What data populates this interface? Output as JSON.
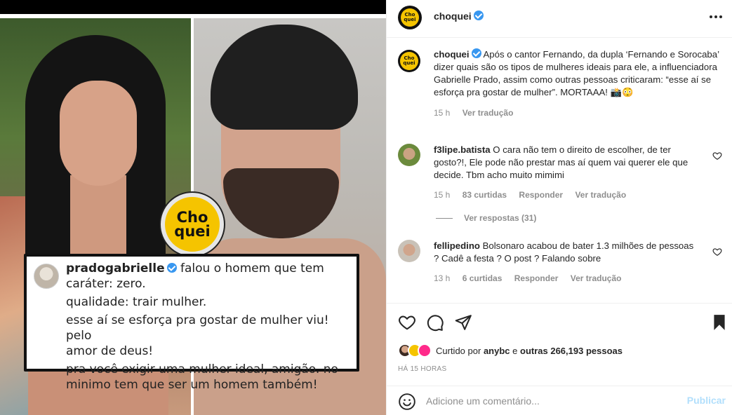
{
  "post_image": {
    "logo_text_top": "Cho",
    "logo_text_bottom": "quei",
    "comment_card": {
      "username": "pradogabrielle",
      "line1_rest": "falou o homem que tem",
      "line2": "caráter: zero.",
      "line3": "qualidade: trair mulher.",
      "line4": "esse aí se esforça pra gostar de mulher viu! pelo",
      "line5": "amor de deus!",
      "line6": "pra você exigir uma mulher ideal, amigão. no",
      "line7": "minimo tem que ser um homem também!"
    }
  },
  "header": {
    "username": "choquei",
    "avatar_text": "Cho quei",
    "more_icon": "more-horizontal-icon"
  },
  "caption": {
    "username": "choquei",
    "text": "Após o cantor Fernando, da dupla ‘Fernando e Sorocaba’ dizer quais são os tipos de mulheres ideais para ele, a influenciadora Gabrielle Prado, assim como outras pessoas criticaram: “esse aí se esforça pra gostar de mulher”. MORTAAA! 📸😳",
    "time": "15 h",
    "translate": "Ver tradução"
  },
  "comments": [
    {
      "username": "f3lipe.batista",
      "text": "O cara não tem o direito de escolher, de ter gosto?!, Ele pode não prestar mas aí quem vai querer ele que decide. Tbm acho muito mimimi",
      "time": "15 h",
      "likes": "83 curtidas",
      "reply": "Responder",
      "translate": "Ver tradução",
      "view_replies": "Ver respostas (31)"
    },
    {
      "username": "fellipedino",
      "text": "Bolsonaro acabou de bater 1.3 milhões de pessoas ? Cadê a festa ? O post ? Falando sobre",
      "time": "13 h",
      "likes": "6 curtidas",
      "reply": "Responder",
      "translate": "Ver tradução"
    }
  ],
  "actions": {
    "like_icon": "heart-icon",
    "comment_icon": "comment-icon",
    "share_icon": "send-icon",
    "save_icon": "bookmark-icon"
  },
  "likes": {
    "prefix": "Curtido por",
    "user": "anybc",
    "joiner": "e",
    "others": "outras 266,193 pessoas"
  },
  "time_ago": "HÁ 15 HORAS",
  "comment_box": {
    "placeholder": "Adicione um comentário...",
    "publish": "Publicar"
  },
  "colors": {
    "verified": "#3897f0",
    "brand_yellow": "#f5c400",
    "publish_disabled": "#b2dffc",
    "muted": "#8e8e8e"
  }
}
